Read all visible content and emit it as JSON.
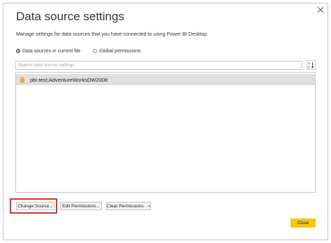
{
  "dialog": {
    "title": "Data source settings",
    "description": "Manage settings for data sources that you have connected to using Power BI Desktop.",
    "close_icon": "close-icon"
  },
  "scope": {
    "options": [
      {
        "label": "Data sources in current file",
        "selected": true
      },
      {
        "label": "Global permissions",
        "selected": false
      }
    ]
  },
  "search": {
    "placeholder": "Search data source settings",
    "sort_icon": "sort-az-icon"
  },
  "data_sources": [
    {
      "label": "pbi-test;AdventureWorksDW2008",
      "icon": "database-icon",
      "selected": true
    }
  ],
  "actions": {
    "change_source": "Change Source...",
    "edit_permissions": "Edit Permissions...",
    "clear_permissions": "Clear Permissions",
    "close": "Close"
  },
  "colors": {
    "accent": "#f2c811",
    "highlight": "#d9342b",
    "selected_row": "#e1dfdd"
  }
}
